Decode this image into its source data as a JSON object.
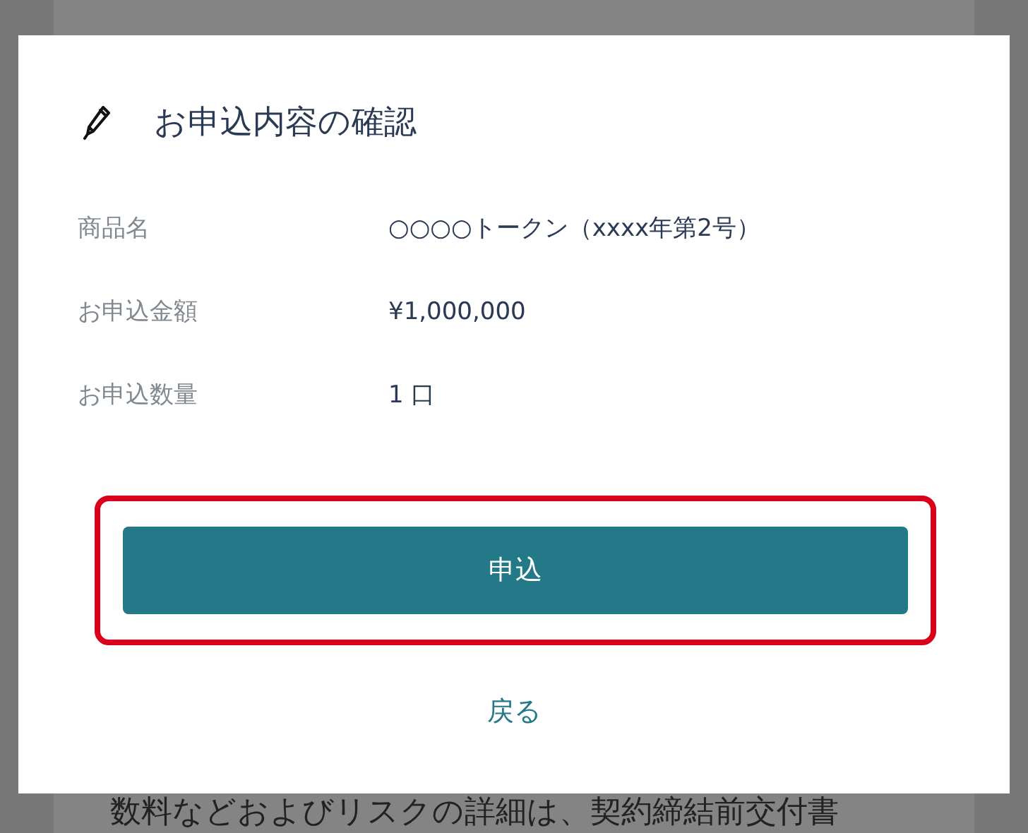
{
  "background_page": {
    "text": "数料などおよびリスクの詳細は、契約締結前交付書"
  },
  "dialog": {
    "title": "お申込内容の確認",
    "rows": [
      {
        "label": "商品名",
        "value": "○○○○トークン（xxxx年第2号）"
      },
      {
        "label": "お申込金額",
        "value": "¥1,000,000"
      },
      {
        "label": "お申込数量",
        "value": "1 口"
      }
    ],
    "primary_button": {
      "label": "申込",
      "highlighted": true
    },
    "back_link": "戻る"
  }
}
